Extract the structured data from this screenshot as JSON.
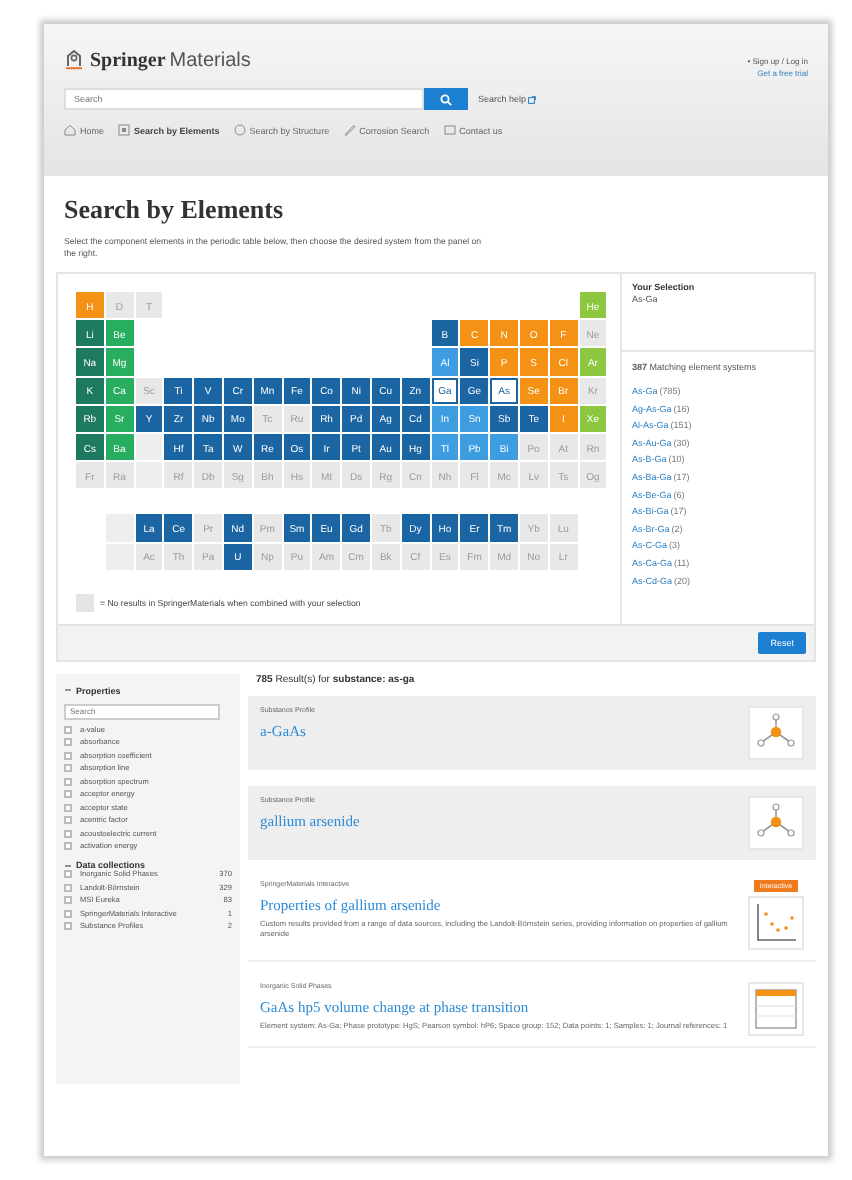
{
  "header": {
    "logo": {
      "brand": "Springer",
      "product": "Materials"
    },
    "account_links": [
      "• Sign up / Log in",
      "Get a free trial"
    ],
    "search": {
      "placeholder": "Search"
    },
    "search_help": "Search help",
    "nav": [
      {
        "label": "Home",
        "selected": false
      },
      {
        "label": "Search by Elements",
        "selected": true
      },
      {
        "label": "Search by Structure",
        "selected": false
      },
      {
        "label": "Corrosion Search",
        "selected": false
      },
      {
        "label": "Contact us",
        "selected": false
      }
    ]
  },
  "title": "Search by Elements",
  "description": "Select the component elements in the periodic table below, then choose the desired system from the panel on the right.",
  "periodic_table": {
    "rows": [
      [
        {
          "symbol": "H",
          "kind": "available",
          "color": "#f39214"
        },
        {
          "symbol": "D",
          "kind": "unavailable"
        },
        {
          "symbol": "T",
          "kind": "unavailable"
        },
        {
          "kind": "gap"
        },
        {
          "kind": "gap"
        },
        {
          "kind": "gap"
        },
        {
          "kind": "gap"
        },
        {
          "kind": "gap"
        },
        {
          "kind": "gap"
        },
        {
          "kind": "gap"
        },
        {
          "kind": "gap"
        },
        {
          "kind": "gap"
        },
        {
          "kind": "gap"
        },
        {
          "kind": "gap"
        },
        {
          "kind": "gap"
        },
        {
          "kind": "gap"
        },
        {
          "kind": "gap"
        },
        {
          "symbol": "He",
          "kind": "available",
          "color": "#8dc63f"
        }
      ],
      [
        {
          "symbol": "Li",
          "kind": "available",
          "color": "#1d7a60"
        },
        {
          "symbol": "Be",
          "kind": "available",
          "color": "#27ae60"
        },
        {
          "kind": "gap"
        },
        {
          "kind": "gap"
        },
        {
          "kind": "gap"
        },
        {
          "kind": "gap"
        },
        {
          "kind": "gap"
        },
        {
          "kind": "gap"
        },
        {
          "kind": "gap"
        },
        {
          "kind": "gap"
        },
        {
          "kind": "gap"
        },
        {
          "kind": "gap"
        },
        {
          "symbol": "B",
          "kind": "available",
          "color": "#1c65a3"
        },
        {
          "symbol": "C",
          "kind": "available",
          "color": "#f39214"
        },
        {
          "symbol": "N",
          "kind": "available",
          "color": "#f39214"
        },
        {
          "symbol": "O",
          "kind": "available",
          "color": "#f39214"
        },
        {
          "symbol": "F",
          "kind": "available",
          "color": "#f39214"
        },
        {
          "symbol": "Ne",
          "kind": "unavailable"
        }
      ],
      [
        {
          "symbol": "Na",
          "kind": "available",
          "color": "#1d7a60"
        },
        {
          "symbol": "Mg",
          "kind": "available",
          "color": "#27ae60"
        },
        {
          "kind": "gap"
        },
        {
          "kind": "gap"
        },
        {
          "kind": "gap"
        },
        {
          "kind": "gap"
        },
        {
          "kind": "gap"
        },
        {
          "kind": "gap"
        },
        {
          "kind": "gap"
        },
        {
          "kind": "gap"
        },
        {
          "kind": "gap"
        },
        {
          "kind": "gap"
        },
        {
          "symbol": "Al",
          "kind": "available",
          "color": "#3d9de0"
        },
        {
          "symbol": "Si",
          "kind": "available",
          "color": "#1c65a3"
        },
        {
          "symbol": "P",
          "kind": "available",
          "color": "#f39214"
        },
        {
          "symbol": "S",
          "kind": "available",
          "color": "#f39214"
        },
        {
          "symbol": "Cl",
          "kind": "available",
          "color": "#f39214"
        },
        {
          "symbol": "Ar",
          "kind": "available",
          "color": "#8dc63f"
        }
      ],
      [
        {
          "symbol": "K",
          "kind": "available",
          "color": "#1d7a60"
        },
        {
          "symbol": "Ca",
          "kind": "available",
          "color": "#27ae60"
        },
        {
          "symbol": "Sc",
          "kind": "unavailable"
        },
        {
          "symbol": "Ti",
          "kind": "available",
          "color": "#1c65a3"
        },
        {
          "symbol": "V",
          "kind": "available",
          "color": "#1c65a3"
        },
        {
          "symbol": "Cr",
          "kind": "available",
          "color": "#1c65a3"
        },
        {
          "symbol": "Mn",
          "kind": "available",
          "color": "#1c65a3"
        },
        {
          "symbol": "Fe",
          "kind": "available",
          "color": "#1c65a3"
        },
        {
          "symbol": "Co",
          "kind": "available",
          "color": "#1c65a3"
        },
        {
          "symbol": "Ni",
          "kind": "available",
          "color": "#1c65a3"
        },
        {
          "symbol": "Cu",
          "kind": "available",
          "color": "#1c65a3"
        },
        {
          "symbol": "Zn",
          "kind": "available",
          "color": "#1c65a3"
        },
        {
          "symbol": "Ga",
          "kind": "selected"
        },
        {
          "symbol": "Ge",
          "kind": "available",
          "color": "#1c65a3"
        },
        {
          "symbol": "As",
          "kind": "selected"
        },
        {
          "symbol": "Se",
          "kind": "available",
          "color": "#f39214"
        },
        {
          "symbol": "Br",
          "kind": "available",
          "color": "#f39214"
        },
        {
          "symbol": "Kr",
          "kind": "unavailable"
        }
      ],
      [
        {
          "symbol": "Rb",
          "kind": "available",
          "color": "#1d7a60"
        },
        {
          "symbol": "Sr",
          "kind": "available",
          "color": "#27ae60"
        },
        {
          "symbol": "Y",
          "kind": "available",
          "color": "#1c65a3"
        },
        {
          "symbol": "Zr",
          "kind": "available",
          "color": "#1c65a3"
        },
        {
          "symbol": "Nb",
          "kind": "available",
          "color": "#1c65a3"
        },
        {
          "symbol": "Mo",
          "kind": "available",
          "color": "#1c65a3"
        },
        {
          "symbol": "Tc",
          "kind": "unavailable"
        },
        {
          "symbol": "Ru",
          "kind": "unavailable"
        },
        {
          "symbol": "Rh",
          "kind": "available",
          "color": "#1c65a3"
        },
        {
          "symbol": "Pd",
          "kind": "available",
          "color": "#1c65a3"
        },
        {
          "symbol": "Ag",
          "kind": "available",
          "color": "#1c65a3"
        },
        {
          "symbol": "Cd",
          "kind": "available",
          "color": "#1c65a3"
        },
        {
          "symbol": "In",
          "kind": "available",
          "color": "#3d9de0"
        },
        {
          "symbol": "Sn",
          "kind": "available",
          "color": "#3d9de0"
        },
        {
          "symbol": "Sb",
          "kind": "available",
          "color": "#1c65a3"
        },
        {
          "symbol": "Te",
          "kind": "available",
          "color": "#1c65a3"
        },
        {
          "symbol": "I",
          "kind": "available",
          "color": "#f39214"
        },
        {
          "symbol": "Xe",
          "kind": "available",
          "color": "#8dc63f"
        }
      ],
      [
        {
          "symbol": "Cs",
          "kind": "available",
          "color": "#1d7a60"
        },
        {
          "symbol": "Ba",
          "kind": "available",
          "color": "#27ae60"
        },
        {
          "kind": "blank"
        },
        {
          "symbol": "Hf",
          "kind": "available",
          "color": "#1c65a3"
        },
        {
          "symbol": "Ta",
          "kind": "available",
          "color": "#1c65a3"
        },
        {
          "symbol": "W",
          "kind": "available",
          "color": "#1c65a3"
        },
        {
          "symbol": "Re",
          "kind": "available",
          "color": "#1c65a3"
        },
        {
          "symbol": "Os",
          "kind": "available",
          "color": "#1c65a3"
        },
        {
          "symbol": "Ir",
          "kind": "available",
          "color": "#1c65a3"
        },
        {
          "symbol": "Pt",
          "kind": "available",
          "color": "#1c65a3"
        },
        {
          "symbol": "Au",
          "kind": "available",
          "color": "#1c65a3"
        },
        {
          "symbol": "Hg",
          "kind": "available",
          "color": "#1c65a3"
        },
        {
          "symbol": "Tl",
          "kind": "available",
          "color": "#3d9de0"
        },
        {
          "symbol": "Pb",
          "kind": "available",
          "color": "#3d9de0"
        },
        {
          "symbol": "Bi",
          "kind": "available",
          "color": "#3d9de0"
        },
        {
          "symbol": "Po",
          "kind": "unavailable"
        },
        {
          "symbol": "At",
          "kind": "unavailable"
        },
        {
          "symbol": "Rn",
          "kind": "unavailable"
        }
      ],
      [
        {
          "symbol": "Fr",
          "kind": "unavailable"
        },
        {
          "symbol": "Ra",
          "kind": "unavailable"
        },
        {
          "kind": "blank"
        },
        {
          "symbol": "Rf",
          "kind": "unavailable"
        },
        {
          "symbol": "Db",
          "kind": "unavailable"
        },
        {
          "symbol": "Sg",
          "kind": "unavailable"
        },
        {
          "symbol": "Bh",
          "kind": "unavailable"
        },
        {
          "symbol": "Hs",
          "kind": "unavailable"
        },
        {
          "symbol": "Mt",
          "kind": "unavailable"
        },
        {
          "symbol": "Ds",
          "kind": "unavailable"
        },
        {
          "symbol": "Rg",
          "kind": "unavailable"
        },
        {
          "symbol": "Cn",
          "kind": "unavailable"
        },
        {
          "symbol": "Nh",
          "kind": "unavailable"
        },
        {
          "symbol": "Fl",
          "kind": "unavailable"
        },
        {
          "symbol": "Mc",
          "kind": "unavailable"
        },
        {
          "symbol": "Lv",
          "kind": "unavailable"
        },
        {
          "symbol": "Ts",
          "kind": "unavailable"
        },
        {
          "symbol": "Og",
          "kind": "unavailable"
        }
      ]
    ],
    "f_block_rows": [
      [
        {
          "kind": "gap"
        },
        {
          "kind": "blank"
        },
        {
          "symbol": "La",
          "kind": "available",
          "color": "#1c65a3"
        },
        {
          "symbol": "Ce",
          "kind": "available",
          "color": "#1c65a3"
        },
        {
          "symbol": "Pr",
          "kind": "unavailable"
        },
        {
          "symbol": "Nd",
          "kind": "available",
          "color": "#1c65a3"
        },
        {
          "symbol": "Pm",
          "kind": "unavailable"
        },
        {
          "symbol": "Sm",
          "kind": "available",
          "color": "#1c65a3"
        },
        {
          "symbol": "Eu",
          "kind": "available",
          "color": "#1c65a3"
        },
        {
          "symbol": "Gd",
          "kind": "available",
          "color": "#1c65a3"
        },
        {
          "symbol": "Tb",
          "kind": "unavailable"
        },
        {
          "symbol": "Dy",
          "kind": "available",
          "color": "#1c65a3"
        },
        {
          "symbol": "Ho",
          "kind": "available",
          "color": "#1c65a3"
        },
        {
          "symbol": "Er",
          "kind": "available",
          "color": "#1c65a3"
        },
        {
          "symbol": "Tm",
          "kind": "available",
          "color": "#1c65a3"
        },
        {
          "symbol": "Yb",
          "kind": "unavailable"
        },
        {
          "symbol": "Lu",
          "kind": "unavailable"
        },
        {
          "kind": "gap"
        }
      ],
      [
        {
          "kind": "gap"
        },
        {
          "kind": "blank"
        },
        {
          "symbol": "Ac",
          "kind": "unavailable"
        },
        {
          "symbol": "Th",
          "kind": "unavailable"
        },
        {
          "symbol": "Pa",
          "kind": "unavailable"
        },
        {
          "symbol": "U",
          "kind": "available",
          "color": "#1c65a3"
        },
        {
          "symbol": "Np",
          "kind": "unavailable"
        },
        {
          "symbol": "Pu",
          "kind": "unavailable"
        },
        {
          "symbol": "Am",
          "kind": "unavailable"
        },
        {
          "symbol": "Cm",
          "kind": "unavailable"
        },
        {
          "symbol": "Bk",
          "kind": "unavailable"
        },
        {
          "symbol": "Cf",
          "kind": "unavailable"
        },
        {
          "symbol": "Es",
          "kind": "unavailable"
        },
        {
          "symbol": "Fm",
          "kind": "unavailable"
        },
        {
          "symbol": "Md",
          "kind": "unavailable"
        },
        {
          "symbol": "No",
          "kind": "unavailable"
        },
        {
          "symbol": "Lr",
          "kind": "unavailable"
        },
        {
          "kind": "gap"
        }
      ]
    ],
    "legend": "= No results in SpringerMaterials when combined with your selection"
  },
  "selection_panel": {
    "heading": "Your Selection",
    "value": "As-Ga",
    "matches": "**387** Matching element systems",
    "systems": [
      {
        "name": "As-Ga",
        "count": "(785)"
      },
      {
        "name": "Ag-As-Ga",
        "count": "(16)"
      },
      {
        "name": "Al-As-Ga",
        "count": "(151)"
      },
      {
        "name": "As-Au-Ga",
        "count": "(30)"
      },
      {
        "name": "As-B-Ga",
        "count": "(10)"
      },
      {
        "name": "As-Ba-Ga",
        "count": "(17)"
      },
      {
        "name": "As-Be-Ga",
        "count": "(6)"
      },
      {
        "name": "As-Bi-Ga",
        "count": "(17)"
      },
      {
        "name": "As-Br-Ga",
        "count": "(2)"
      },
      {
        "name": "As-C-Ga",
        "count": "(3)"
      },
      {
        "name": "As-Ca-Ga",
        "count": "(11)"
      },
      {
        "name": "As-Cd-Ga",
        "count": "(20)"
      }
    ],
    "reset_button": "Reset"
  },
  "sidebar": {
    "properties": {
      "heading": "Properties",
      "expanded": true,
      "search_placeholder": "Search",
      "items": [
        {
          "label": "a-value",
          "checked": false
        },
        {
          "label": "absorbance",
          "checked": false
        },
        {
          "label": "absorption coefficient",
          "checked": false
        },
        {
          "label": "absorption line",
          "checked": false
        },
        {
          "label": "absorption spectrum",
          "checked": false
        },
        {
          "label": "acceptor energy",
          "checked": false
        },
        {
          "label": "acceptor state",
          "checked": false
        },
        {
          "label": "acentric factor",
          "checked": false
        },
        {
          "label": "acoustoelectric current",
          "checked": false
        },
        {
          "label": "activation energy",
          "checked": false
        }
      ]
    },
    "data_collections": {
      "heading": "Data collections",
      "expanded": true,
      "items": [
        {
          "label": "Inorganic Solid Phases",
          "count": "370",
          "checked": false
        },
        {
          "label": "Landolt-Börnstein",
          "count": "329",
          "checked": false
        },
        {
          "label": "MSI Eureka",
          "count": "83",
          "checked": false
        },
        {
          "label": "SpringerMaterials Interactive",
          "count": "1",
          "checked": false
        },
        {
          "label": "Substance Profiles",
          "count": "2",
          "checked": false
        }
      ]
    }
  },
  "results": {
    "summary": "**785** Result(s) for **substance: as-ga**",
    "items": [
      {
        "kind": "profile",
        "source": "Substance Profile",
        "title": "a-GaAs"
      },
      {
        "kind": "profile",
        "source": "Substance Profile",
        "title": "gallium arsenide"
      },
      {
        "kind": "interactive",
        "source": "SpringerMaterials Interactive",
        "title": "Properties of gallium arsenide",
        "badge": "Interactive",
        "description": "Custom results provided from a range of data sources, including the Landolt-Börnstein series, providing information on properties of gallium arsenide"
      },
      {
        "kind": "phase",
        "source": "Inorganic Solid Phases",
        "title": "GaAs hp5 volume change at phase transition",
        "description": "Element system: As-Ga; Phase prototype: HgS; Pearson symbol: hP6; Space group: 152; Data points: 1; Samples: 1; Journal references: 1"
      }
    ]
  }
}
